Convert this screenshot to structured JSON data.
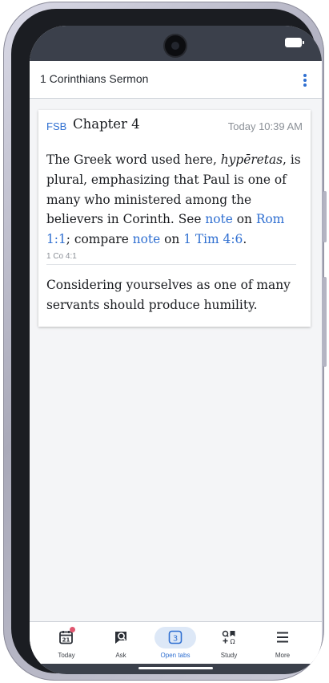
{
  "app": {
    "title": "1 Corinthians Sermon"
  },
  "note": {
    "source": "FSB",
    "chapter": "Chapter 4",
    "timestamp": "Today 10:39 AM",
    "paragraph1": {
      "part1": "The Greek word used here, ",
      "greek": "hypēretas",
      "part2": ", is plural, emphasizing that Paul is one of many who ministered among the believers in Corinth. See ",
      "link_note1": "note",
      "part3": " on ",
      "link_rom": "Rom 1:1",
      "part4": "; compare ",
      "link_note2": "note",
      "part5": " on ",
      "link_tim": "1 Tim 4:6",
      "part6": "."
    },
    "reference": "1 Co 4:1",
    "paragraph2": "Considering yourselves as one of many servants should produce humility."
  },
  "nav": {
    "today": {
      "label": "Today",
      "date": "21"
    },
    "ask": {
      "label": "Ask"
    },
    "open_tabs": {
      "label": "Open tabs",
      "count": "3"
    },
    "study": {
      "label": "Study"
    },
    "more": {
      "label": "More"
    }
  },
  "colors": {
    "accent": "#2f6fd1",
    "status_bar": "#3b404b",
    "badge": "#e0566f"
  },
  "icons": [
    "calendar-icon",
    "ask-chat-icon",
    "tabs-icon",
    "study-icon",
    "menu-icon",
    "more-vertical-icon",
    "camera-icon",
    "battery-icon"
  ]
}
